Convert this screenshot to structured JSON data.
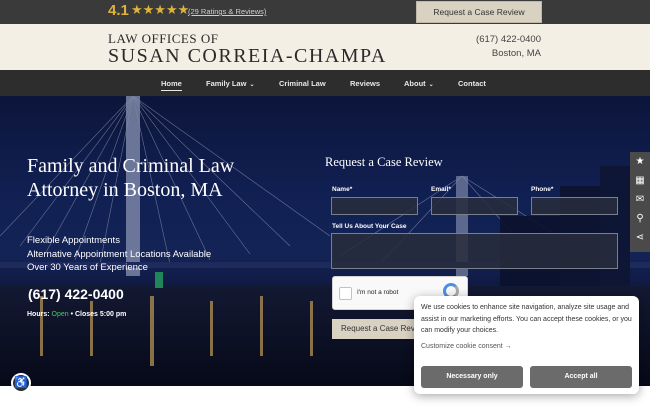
{
  "topbar": {
    "rating": "4.1",
    "stars": "★★★★★",
    "ratings_link": "(29 Ratings & Reviews)",
    "cta": "Request a Case Review"
  },
  "header": {
    "logo_line1": "LAW OFFICES OF",
    "logo_line2": "SUSAN CORREIA-CHAMPA",
    "phone": "(617) 422-0400",
    "city": "Boston, MA"
  },
  "nav": {
    "items": [
      {
        "label": "Home"
      },
      {
        "label": "Family Law"
      },
      {
        "label": "Criminal Law"
      },
      {
        "label": "Reviews"
      },
      {
        "label": "About"
      },
      {
        "label": "Contact"
      }
    ],
    "chevron": "⌄"
  },
  "hero": {
    "title": "Family and Criminal Law Attorney in Boston, MA",
    "features": [
      "Flexible Appointments",
      "Alternative Appointment Locations Available",
      "Over 30 Years of Experience"
    ],
    "phone": "(617) 422-0400",
    "hours_label": "Hours:",
    "hours_status": "Open",
    "hours_close": "• Closes 5:00 pm"
  },
  "form": {
    "title": "Request a Case Review",
    "name_label": "Name*",
    "email_label": "Email*",
    "phone_label": "Phone*",
    "message_label": "Tell Us About Your Case",
    "captcha_text": "I'm not a robot",
    "submit": "Request a Case Review"
  },
  "side_rail": {
    "icons": [
      "star-icon",
      "calendar-icon",
      "mail-icon",
      "location-icon",
      "share-icon"
    ],
    "glyphs": [
      "★",
      "▦",
      "✉",
      "⚲",
      "⋖"
    ]
  },
  "cookie": {
    "text": "We use cookies to enhance site navigation, analyze site usage and assist in our marketing efforts. You can accept these cookies, or you can modify your choices.",
    "customize": "Customize cookie consent →",
    "necessary": "Necessary only",
    "accept": "Accept all"
  },
  "accessibility": {
    "glyph": "♿"
  },
  "colors": {
    "star": "#e0b23b",
    "open": "#3fcf5b",
    "nav_bg": "#2d2d2d",
    "header_bg": "#f3efe5"
  }
}
